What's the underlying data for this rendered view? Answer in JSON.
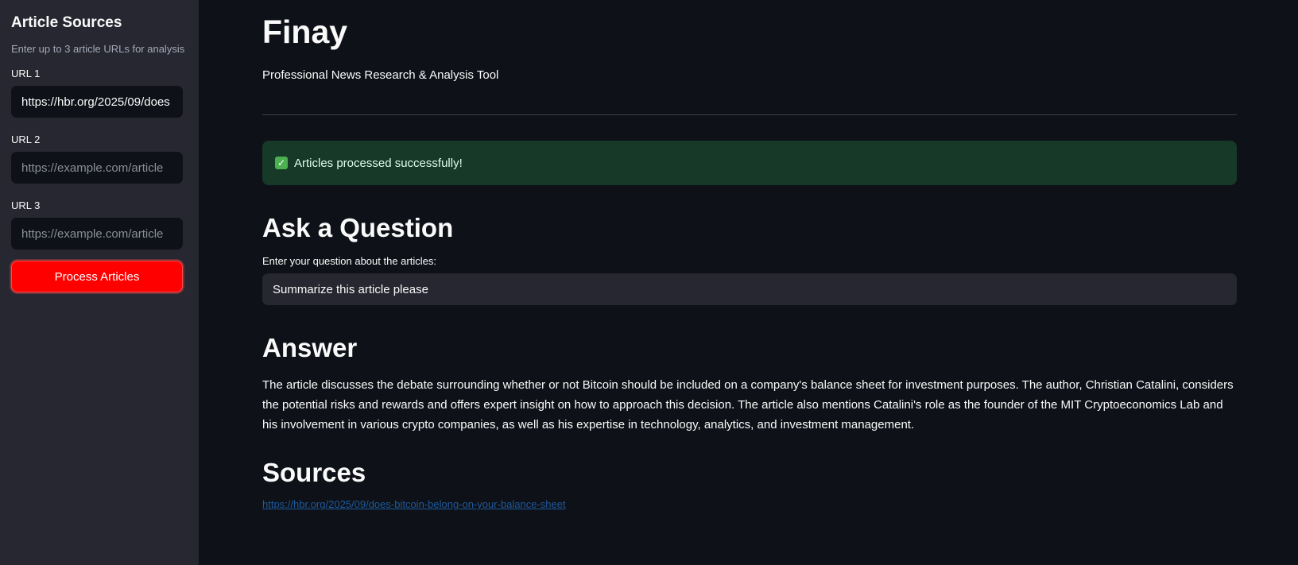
{
  "sidebar": {
    "title": "Article Sources",
    "caption": "Enter up to 3 article URLs for analysis",
    "url_fields": [
      {
        "label": "URL 1",
        "value": "https://hbr.org/2025/09/does",
        "placeholder": "https://example.com/article"
      },
      {
        "label": "URL 2",
        "value": "",
        "placeholder": "https://example.com/article"
      },
      {
        "label": "URL 3",
        "value": "",
        "placeholder": "https://example.com/article"
      }
    ],
    "process_button": "Process Articles"
  },
  "main": {
    "title": "Finay",
    "subtitle": "Professional News Research & Analysis Tool",
    "alert": {
      "icon": "check-icon",
      "text": "Articles processed successfully!",
      "color": "#173928"
    },
    "ask": {
      "heading": "Ask a Question",
      "input_label": "Enter your question about the articles:",
      "input_value": "Summarize this article please"
    },
    "answer": {
      "heading": "Answer",
      "text": "The article discusses the debate surrounding whether or not Bitcoin should be included on a company's balance sheet for investment purposes. The author, Christian Catalini, considers the potential risks and rewards and offers expert insight on how to approach this decision. The article also mentions Catalini's role as the founder of the MIT Cryptoeconomics Lab and his involvement in various crypto companies, as well as his expertise in technology, analytics, and investment management."
    },
    "sources": {
      "heading": "Sources",
      "links": [
        "https://hbr.org/2025/09/does-bitcoin-belong-on-your-balance-sheet"
      ]
    }
  },
  "colors": {
    "accent": "#ff0000",
    "background": "#0e1117",
    "sidebar": "#262730",
    "link": "#1e5a9e"
  }
}
